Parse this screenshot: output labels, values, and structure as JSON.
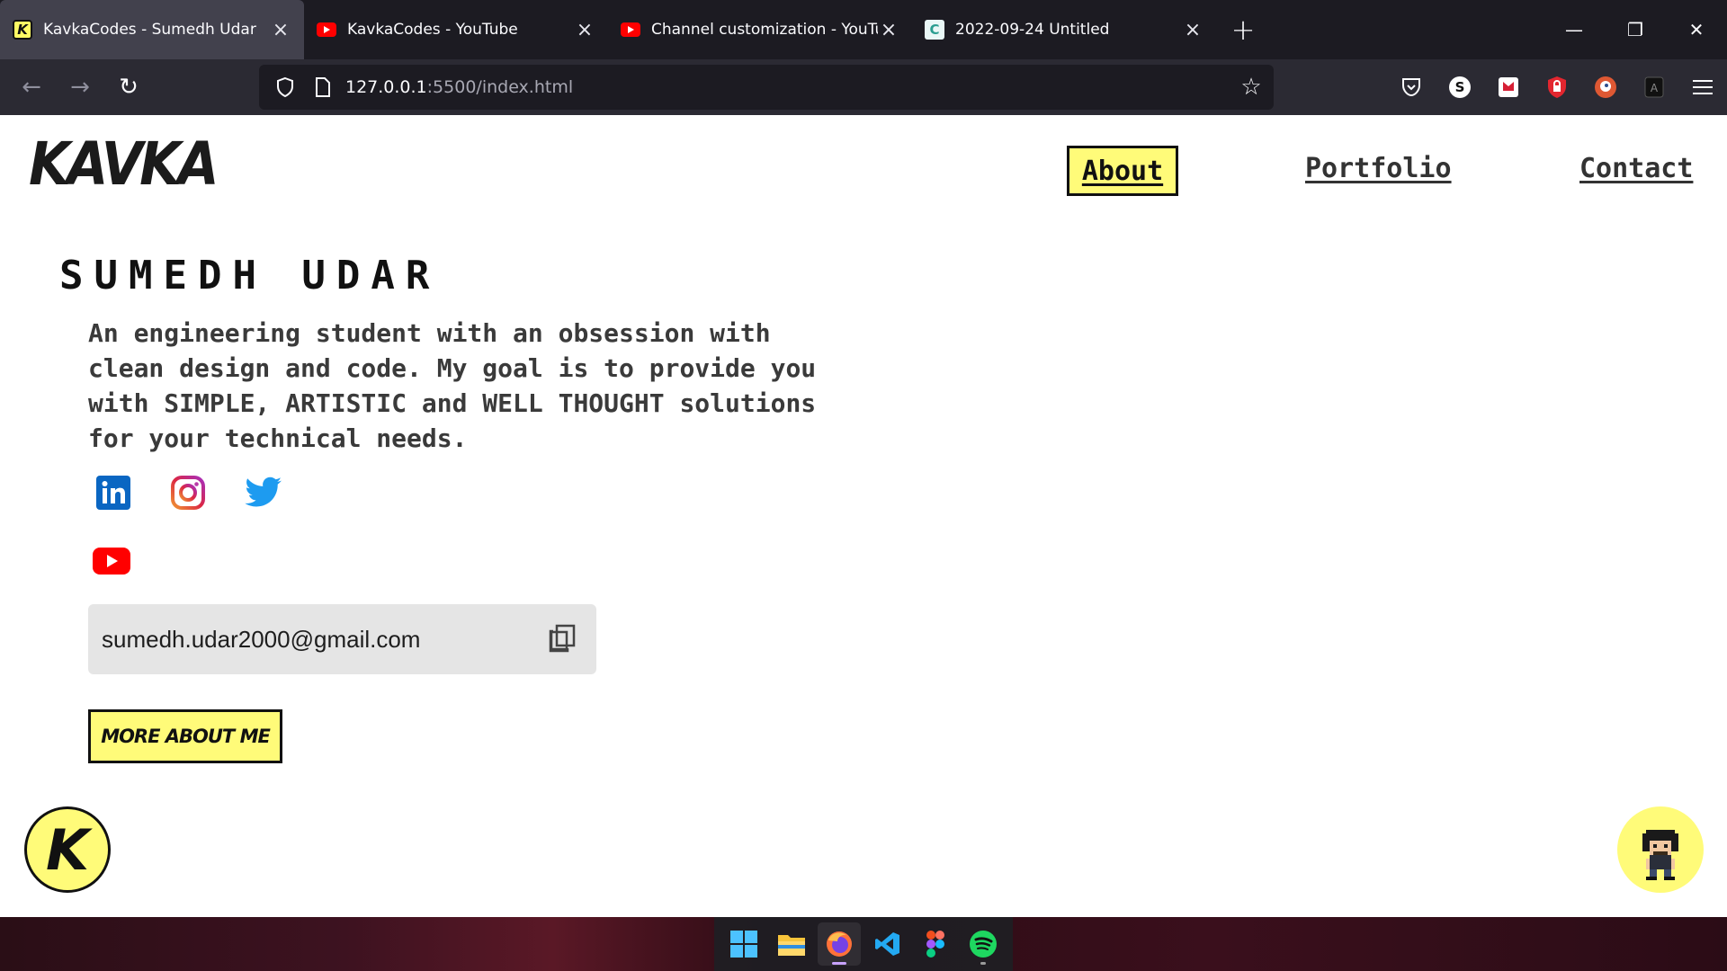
{
  "browser": {
    "tabs": [
      {
        "label": "KavkaCodes - Sumedh Udar",
        "favicon": "kavka-favicon",
        "active": true
      },
      {
        "label": "KavkaCodes - YouTube",
        "favicon": "youtube-favicon",
        "active": false
      },
      {
        "label": "Channel customization - YouTube",
        "favicon": "youtube-favicon",
        "active": false
      },
      {
        "label": "2022-09-24 Untitled",
        "favicon": "canva-favicon",
        "active": false
      }
    ],
    "url_host": "127.0.0.1",
    "url_path": ":5500/index.html",
    "colors": {
      "tabbar": "#1c1b22",
      "toolbar": "#2b2a33",
      "active_tab": "#42414d"
    }
  },
  "site": {
    "logo": "KAVKA",
    "nav": {
      "about": "About",
      "portfolio": "Portfolio",
      "contact": "Contact"
    },
    "name": "SUMEDH UDAR",
    "bio": "An engineering student with an obsession with clean design and code. My goal is to provide you with SIMPLE, ARTISTIC and WELL THOUGHT solutions for your technical needs.",
    "social": [
      "linkedin-icon",
      "instagram-icon",
      "twitter-icon",
      "youtube-icon"
    ],
    "email": "sumedh.udar2000@gmail.com",
    "more_button": "MORE ABOUT ME",
    "corner_logo": "K",
    "colors": {
      "accent_yellow": "#fffb79",
      "dark": "#111111"
    }
  },
  "taskbar": {
    "apps": [
      "windows-start-icon",
      "file-explorer-icon",
      "firefox-icon",
      "vscode-icon",
      "figma-icon",
      "spotify-icon"
    ]
  }
}
